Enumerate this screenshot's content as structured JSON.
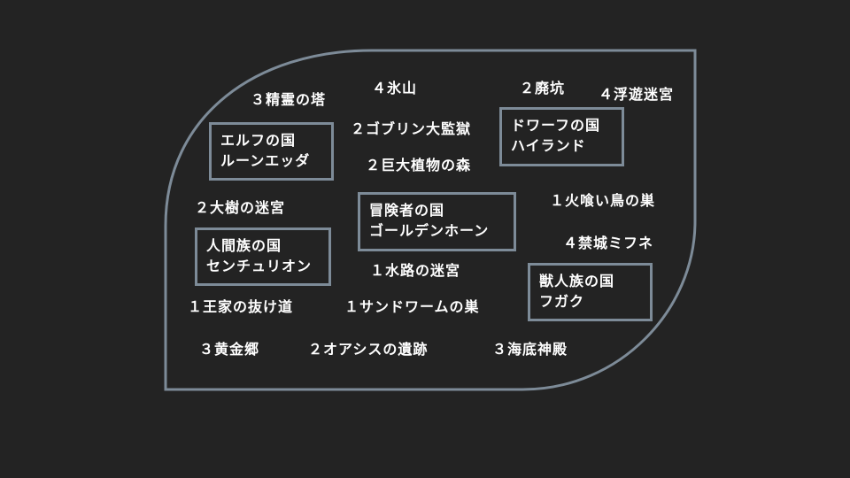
{
  "nations": {
    "elf": {
      "name": "エルフの国",
      "capital": "ルーンエッダ"
    },
    "dwarf": {
      "name": "ドワーフの国",
      "capital": "ハイランド"
    },
    "adventurer": {
      "name": "冒険者の国",
      "capital": "ゴールデンホーン"
    },
    "human": {
      "name": "人間族の国",
      "capital": "センチュリオン"
    },
    "beast": {
      "name": "獣人族の国",
      "capital": "フガク"
    }
  },
  "locations": {
    "seirei_no_tou": "３精霊の塔",
    "hyouzan": "４氷山",
    "haikou": "２廃坑",
    "fuyuu_meikyuu": "４浮遊迷宮",
    "goblin_kangoku": "２ゴブリン大監獄",
    "kyodai_shokubutsu": "２巨大植物の森",
    "taiju_meikyuu": "２大樹の迷宮",
    "hikui_tori": "１火喰い鳥の巣",
    "kinjou_mifune": "４禁城ミフネ",
    "suiro_meikyuu": "１水路の迷宮",
    "ouke_nukemichi": "１王家の抜け道",
    "sandworm": "１サンドワームの巣",
    "ougonkyou": "３黄金郷",
    "oasis_iseki": "２オアシスの遺跡",
    "kaitei_shinden": "３海底神殿"
  }
}
